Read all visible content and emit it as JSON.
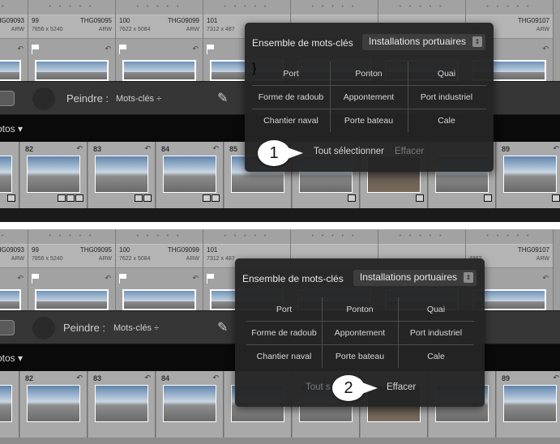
{
  "grid_cells": [
    {
      "num": "",
      "code": "THG09093",
      "dim": "",
      "fmt": "ARW",
      "flag": false
    },
    {
      "num": "99",
      "code": "THG09095",
      "dim": "7856 x 5240",
      "fmt": "ARW",
      "flag": true
    },
    {
      "num": "100",
      "code": "THG09099",
      "dim": "7622 x 5084",
      "fmt": "ARW",
      "flag": true
    },
    {
      "num": "101",
      "code": "",
      "dim": "7312 x 487",
      "fmt": "",
      "flag": true
    },
    {
      "num": "",
      "code": "",
      "dim": "",
      "fmt": "",
      "flag": false
    },
    {
      "num": "",
      "code": "",
      "dim": "",
      "fmt": "",
      "flag": false
    },
    {
      "num": "",
      "code": "THG09107",
      "dim": "4982",
      "fmt": "ARW",
      "flag": false
    }
  ],
  "toolbar": {
    "paint_label": "Peindre :",
    "paint_target": "Mots-clés ÷"
  },
  "filmstrip": {
    "label": "otos ▾",
    "cells": [
      {
        "num": ""
      },
      {
        "num": "82"
      },
      {
        "num": "83"
      },
      {
        "num": "84"
      },
      {
        "num": "85"
      },
      {
        "num": ""
      },
      {
        "num": ""
      },
      {
        "num": "89"
      }
    ]
  },
  "popup": {
    "title": "Ensemble de mots-clés",
    "set_name": "Installations portuaires",
    "keywords": [
      [
        "Port",
        "Ponton",
        "Quai"
      ],
      [
        "Forme de radoub",
        "Appontement",
        "Port industriel"
      ],
      [
        "Chantier naval",
        "Porte bateau",
        "Cale"
      ]
    ],
    "select_all": "Tout sélectionner",
    "clear": "Effacer",
    "select_all_partial": "Tout s"
  },
  "callouts": {
    "one": "1",
    "two": "2"
  }
}
